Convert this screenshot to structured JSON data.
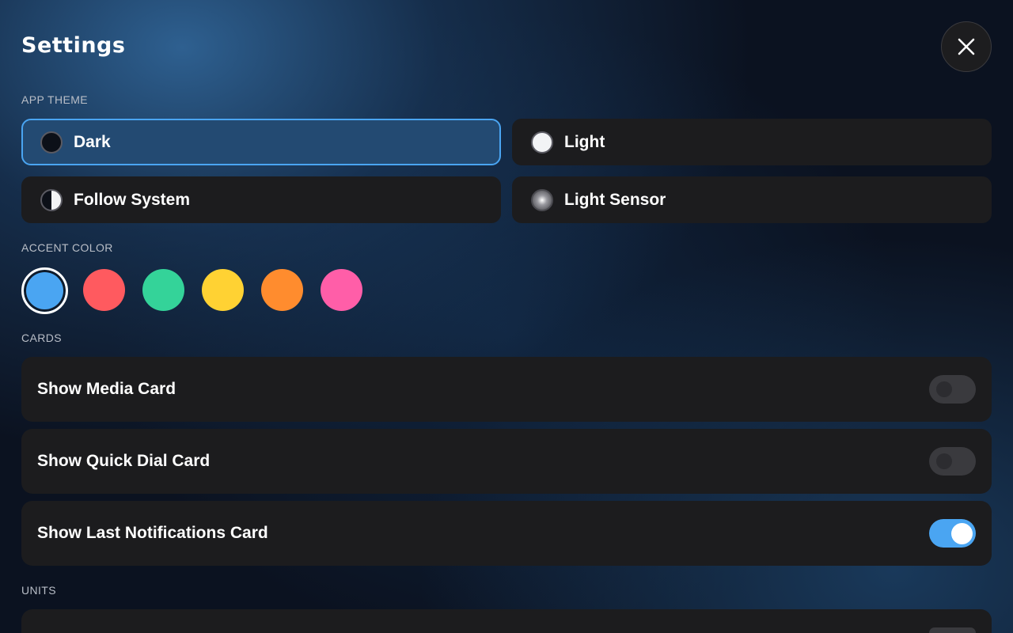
{
  "header": {
    "title": "Settings",
    "close_icon": "close-icon"
  },
  "app_theme": {
    "label": "APP THEME",
    "options": [
      {
        "label": "Dark",
        "icon": "dark-circle-icon",
        "selected": true
      },
      {
        "label": "Light",
        "icon": "light-circle-icon",
        "selected": false
      },
      {
        "label": "Follow System",
        "icon": "half-circle-icon",
        "selected": false
      },
      {
        "label": "Light Sensor",
        "icon": "sensor-glow-icon",
        "selected": false
      }
    ]
  },
  "accent_color": {
    "label": "ACCENT COLOR",
    "swatches": [
      {
        "color": "#4aa5f2",
        "selected": true
      },
      {
        "color": "#ff5a5f",
        "selected": false
      },
      {
        "color": "#34d399",
        "selected": false
      },
      {
        "color": "#ffd233",
        "selected": false
      },
      {
        "color": "#ff8c2e",
        "selected": false
      },
      {
        "color": "#ff5ea8",
        "selected": false
      }
    ]
  },
  "cards": {
    "label": "CARDS",
    "items": [
      {
        "label": "Show Media Card",
        "enabled": false
      },
      {
        "label": "Show Quick Dial Card",
        "enabled": false
      },
      {
        "label": "Show Last Notifications Card",
        "enabled": true
      }
    ]
  },
  "units": {
    "label": "UNITS"
  },
  "colors": {
    "accent": "#4aa5f2",
    "card_bg": "#1c1c1e",
    "selected_bg": "#234a72"
  }
}
